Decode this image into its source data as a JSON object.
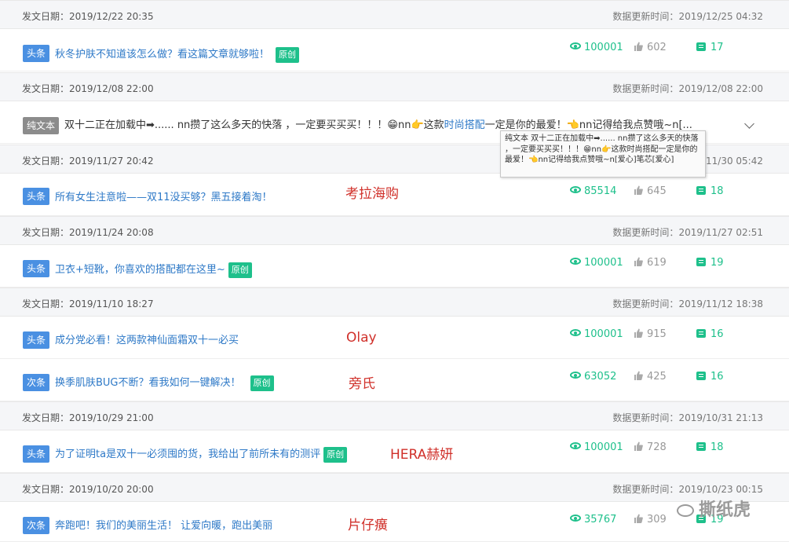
{
  "labels": {
    "publish_prefix": "发文日期：",
    "update_prefix": "数据更新时间："
  },
  "colors": {
    "accent_green": "#1ec08b",
    "link_blue": "#2e79c7",
    "badge_blue": "#4a90e2",
    "brand_red": "#d0302a"
  },
  "groups": [
    {
      "publish": "2019/12/22 20:35",
      "update": "2019/12/25 04:32",
      "items": [
        {
          "badge": "头条",
          "title": "秋冬护肤不知道该怎么做？看这篇文章就够啦！",
          "original": "原创",
          "views": "100001",
          "likes": "602",
          "comments": "17",
          "brand": ""
        }
      ]
    },
    {
      "publish": "2019/12/08 22:00",
      "update": "2019/12/08 22:00",
      "items": [
        {
          "badge": "纯文本",
          "title_pre": "双十二正在加载中➡...... nn攒了这么多天的快落 ，一定要买买买！！！😁nn👉这款",
          "title_kw": "时尚搭配",
          "title_post": "一定是你的最爱！👈nn记得给我点赞哦~n[...",
          "brand": ""
        }
      ]
    },
    {
      "publish": "2019/11/27 20:42",
      "update": "2019/11/30 05:42",
      "items": [
        {
          "badge": "头条",
          "title": "所有女生注意啦——双11没买够？黑五接着淘！",
          "original": "",
          "views": "85514",
          "likes": "645",
          "comments": "18",
          "brand": "考拉海购"
        }
      ]
    },
    {
      "publish": "2019/11/24 20:08",
      "update": "2019/11/27 02:51",
      "items": [
        {
          "badge": "头条",
          "title": "卫衣+短靴，你喜欢的搭配都在这里~",
          "original": "原创",
          "views": "100001",
          "likes": "619",
          "comments": "19",
          "brand": ""
        }
      ]
    },
    {
      "publish": "2019/11/10 18:27",
      "update": "2019/11/12 18:38",
      "items": [
        {
          "badge": "头条",
          "title": "成分党必看！这两款神仙面霜双十一必买",
          "original": "",
          "views": "100001",
          "likes": "915",
          "comments": "16",
          "brand": "Olay"
        },
        {
          "badge": "次条",
          "title": "换季肌肤BUG不断？看我如何一键解决！",
          "original": "原创",
          "views": "63052",
          "likes": "425",
          "comments": "16",
          "brand": "旁氏"
        }
      ]
    },
    {
      "publish": "2019/10/29 21:00",
      "update": "2019/10/31 21:13",
      "items": [
        {
          "badge": "头条",
          "title": "为了证明ta是双十一必须囤的货，我给出了前所未有的测评",
          "original": "原创",
          "views": "100001",
          "likes": "728",
          "comments": "18",
          "brand": "HERA赫妍"
        }
      ]
    },
    {
      "publish": "2019/10/20 20:00",
      "update": "2019/10/23 00:15",
      "items": [
        {
          "badge": "次条",
          "title": "奔跑吧！我们的美丽生活！ 让爱向暖，跑出美丽",
          "original": "",
          "views": "35767",
          "likes": "309",
          "comments": "19",
          "brand": "片仔癀"
        }
      ]
    }
  ],
  "tooltip": "纯文本 双十二正在加载中➡...... nn攒了这么多天的快落 ，一定要买买买！！！😁nn👉这款时尚搭配一定是你的最爱！👈nn记得给我点赞哦~n[爱心]笔芯[爱心]",
  "watermark": "撕纸虎"
}
